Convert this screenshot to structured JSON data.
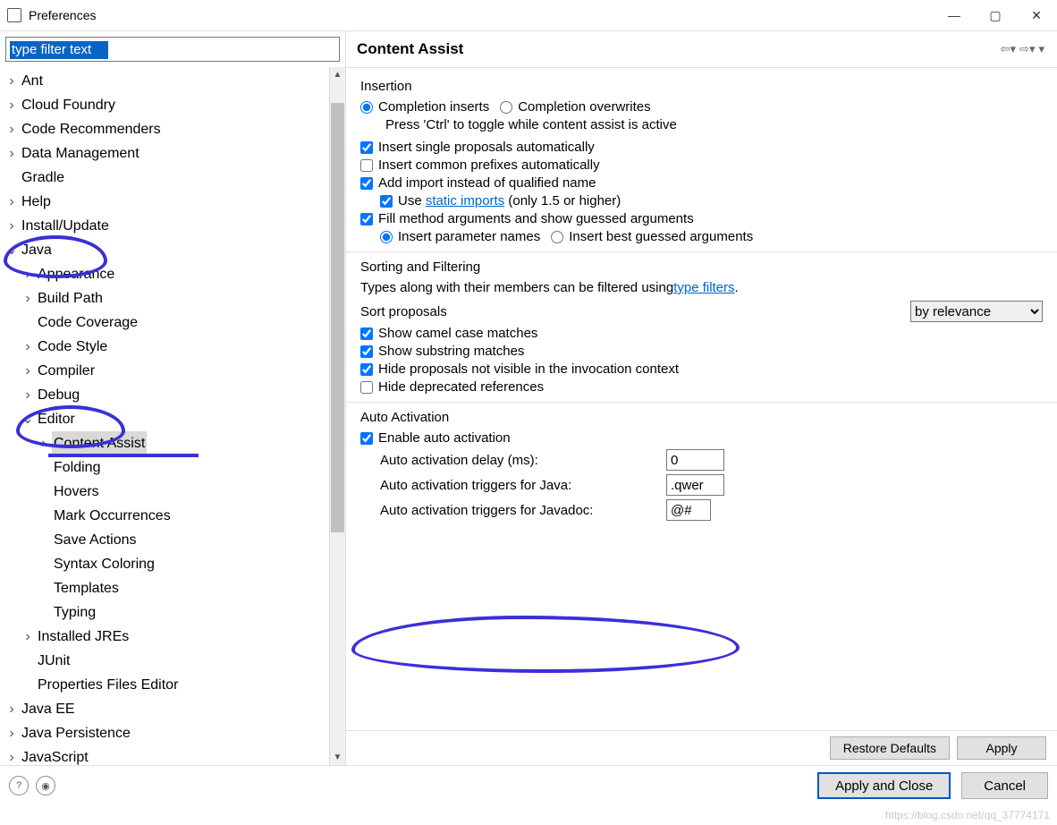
{
  "window": {
    "title": "Preferences"
  },
  "filter": {
    "value": "type filter text"
  },
  "tree": {
    "items": [
      {
        "chev": ">",
        "label": "Ant",
        "ind": 0
      },
      {
        "chev": ">",
        "label": "Cloud Foundry",
        "ind": 0
      },
      {
        "chev": ">",
        "label": "Code Recommenders",
        "ind": 0
      },
      {
        "chev": ">",
        "label": "Data Management",
        "ind": 0
      },
      {
        "chev": "",
        "label": "Gradle",
        "ind": 0
      },
      {
        "chev": ">",
        "label": "Help",
        "ind": 0
      },
      {
        "chev": ">",
        "label": "Install/Update",
        "ind": 0
      },
      {
        "chev": "v",
        "label": "Java",
        "ind": 0
      },
      {
        "chev": ">",
        "label": "Appearance",
        "ind": 1
      },
      {
        "chev": ">",
        "label": "Build Path",
        "ind": 1
      },
      {
        "chev": "",
        "label": "Code Coverage",
        "ind": 1
      },
      {
        "chev": ">",
        "label": "Code Style",
        "ind": 1
      },
      {
        "chev": ">",
        "label": "Compiler",
        "ind": 1
      },
      {
        "chev": ">",
        "label": "Debug",
        "ind": 1
      },
      {
        "chev": "v",
        "label": "Editor",
        "ind": 1
      },
      {
        "chev": ">",
        "label": "Content Assist",
        "ind": 2,
        "selected": true
      },
      {
        "chev": "",
        "label": "Folding",
        "ind": 2
      },
      {
        "chev": "",
        "label": "Hovers",
        "ind": 2
      },
      {
        "chev": "",
        "label": "Mark Occurrences",
        "ind": 2
      },
      {
        "chev": "",
        "label": "Save Actions",
        "ind": 2
      },
      {
        "chev": "",
        "label": "Syntax Coloring",
        "ind": 2
      },
      {
        "chev": "",
        "label": "Templates",
        "ind": 2
      },
      {
        "chev": "",
        "label": "Typing",
        "ind": 2
      },
      {
        "chev": ">",
        "label": "Installed JREs",
        "ind": 1
      },
      {
        "chev": "",
        "label": "JUnit",
        "ind": 1
      },
      {
        "chev": "",
        "label": "Properties Files Editor",
        "ind": 1
      },
      {
        "chev": ">",
        "label": "Java EE",
        "ind": 0
      },
      {
        "chev": ">",
        "label": "Java Persistence",
        "ind": 0
      },
      {
        "chev": ">",
        "label": "JavaScript",
        "ind": 0
      }
    ]
  },
  "header": {
    "title": "Content Assist"
  },
  "insertion": {
    "title": "Insertion",
    "radio_inserts": "Completion inserts",
    "radio_overwrites": "Completion overwrites",
    "hint": "Press 'Ctrl' to toggle while content assist is active",
    "cb_single": "Insert single proposals automatically",
    "cb_common": "Insert common prefixes automatically",
    "cb_import": "Add import instead of qualified name",
    "cb_static_pre": "Use ",
    "cb_static_link": "static imports",
    "cb_static_post": " (only 1.5 or higher)",
    "cb_fill": "Fill method arguments and show guessed arguments",
    "radio_param": "Insert parameter names",
    "radio_best": "Insert best guessed arguments"
  },
  "sorting": {
    "title": "Sorting and Filtering",
    "hint_pre": "Types along with their members can be filtered using ",
    "hint_link": "type filters",
    "sort_label": "Sort proposals",
    "sort_value": "by relevance",
    "cb_camel": "Show camel case matches",
    "cb_substr": "Show substring matches",
    "cb_hide": "Hide proposals not visible in the invocation context",
    "cb_depr": "Hide deprecated references"
  },
  "auto": {
    "title": "Auto Activation",
    "cb_enable": "Enable auto activation",
    "delay_label": "Auto activation delay (ms):",
    "delay_value": "0",
    "java_label": "Auto activation triggers for Java:",
    "java_value": ".qwer",
    "jdoc_label": "Auto activation triggers for Javadoc:",
    "jdoc_value": "@#"
  },
  "buttons": {
    "restore": "Restore Defaults",
    "apply": "Apply",
    "apply_close": "Apply and Close",
    "cancel": "Cancel"
  },
  "watermark": "https://blog.csdn.net/qq_37774171"
}
